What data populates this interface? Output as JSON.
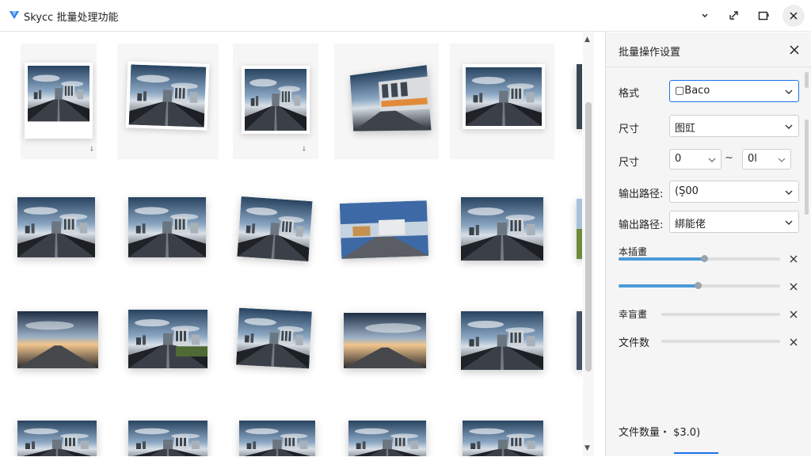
{
  "app": {
    "title": "Skycc 批量处理功能"
  },
  "titlebar": {
    "icons": [
      "minimize-icon",
      "resize-icon",
      "window-icon",
      "close-icon"
    ]
  },
  "gallery": {
    "thumbnails": [
      {
        "style": "frame"
      },
      {
        "style": "frame"
      },
      {
        "style": "frame"
      },
      {
        "style": "tilted"
      },
      {
        "style": "frame"
      },
      {
        "style": "plain"
      },
      {
        "style": "plain"
      },
      {
        "style": "tilted"
      },
      {
        "style": "plain"
      },
      {
        "style": "plain"
      },
      {
        "style": "plain"
      },
      {
        "style": "plain"
      },
      {
        "style": "tilted"
      },
      {
        "style": "plain"
      },
      {
        "style": "plain"
      },
      {
        "style": "plain"
      },
      {
        "style": "plain"
      },
      {
        "style": "plain"
      },
      {
        "style": "plain"
      },
      {
        "style": "plain"
      }
    ]
  },
  "panel": {
    "title": "批量操作设置",
    "format": {
      "label": "格式",
      "value": "▢Baco"
    },
    "size1": {
      "label": "尺寸",
      "value": "图豇"
    },
    "size2": {
      "label": "尺寸",
      "from": "0",
      "sep": "~",
      "to": "0l"
    },
    "output1": {
      "label": "输出路径:",
      "value": "(Ş00"
    },
    "output2": {
      "label": "输出路径:",
      "value": "綁能佬"
    },
    "slider1": {
      "label": "本插畫",
      "level": 0.53
    },
    "slider2": {
      "label": "",
      "level": 0.49
    },
    "slider3": {
      "label": "幸盲畫",
      "level": 0.0
    },
    "slider4": {
      "label": "文件数",
      "level": 0.0
    },
    "file_count": "文件数量・ $3.0)"
  },
  "colors": {
    "accent": "#1a73e8",
    "slider_fill": "#4b9bd8",
    "panel_bg": "#f5f5f5"
  }
}
